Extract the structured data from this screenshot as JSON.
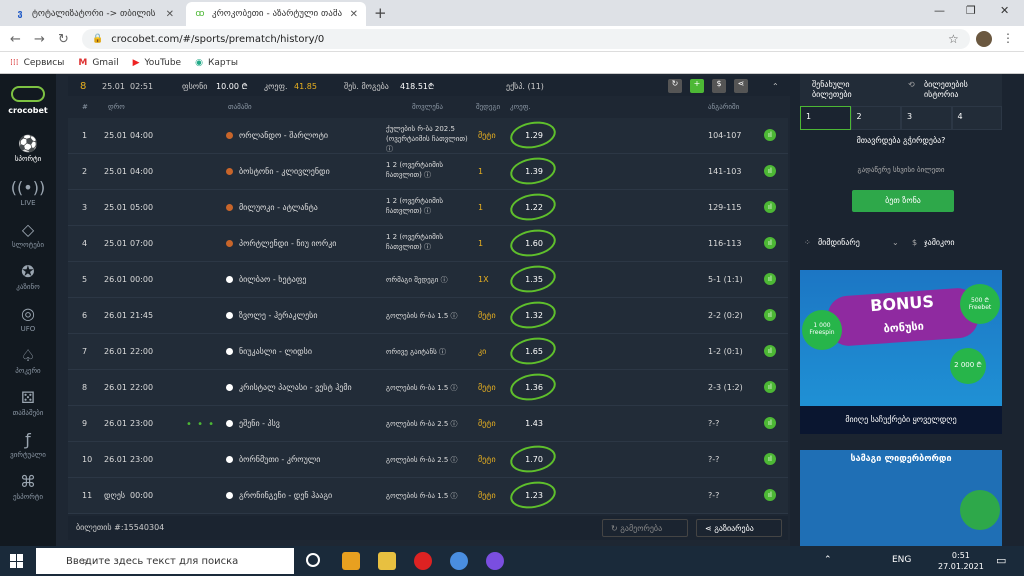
{
  "browser": {
    "tabs": [
      {
        "title": "ტოტალიზატორი -> თბილის",
        "icon": "tab-icon"
      },
      {
        "title": "კროკობეთი - აზარტული თამა",
        "icon": "crocobet-icon"
      }
    ],
    "url": "crocobet.com/#/sports/prematch/history/0",
    "bookmarks": [
      "Сервисы",
      "Gmail",
      "YouTube",
      "Карты"
    ]
  },
  "topbar": {
    "date": "25.01",
    "time": "02:51",
    "stake": "ფსონი",
    "stake_val": "10.00 ₾",
    "coef_label": "კოეფ.",
    "coef_val": "41.85",
    "win_label": "შეს. მოგება",
    "win_val": "418.51₾",
    "type": "ექსპ. (11)"
  },
  "headers": {
    "num": "#",
    "date": "დრო",
    "event": "თამაში",
    "market": "მოვლენა",
    "pick": "შედეგი",
    "odds": "კოეფ.",
    "result": "ანგარიში"
  },
  "rows": [
    {
      "num": "1",
      "date": "25.01",
      "time": "04:00",
      "sport": "ball",
      "event": "ორლანდო - შარლოტი",
      "market": "ქულების რ-ბა 202.5 (ოვერტაიმის ჩათვლით) ⓘ",
      "pick": "მეტი",
      "odds": "1.29",
      "score": "104-107",
      "circled": true
    },
    {
      "num": "2",
      "date": "25.01",
      "time": "04:00",
      "sport": "ball",
      "event": "ბოსტონი - კლივლენდი",
      "market": "1 2 (ოვერტაიმის ჩათვლით) ⓘ",
      "pick": "1",
      "odds": "1.39",
      "score": "141-103",
      "circled": true
    },
    {
      "num": "3",
      "date": "25.01",
      "time": "05:00",
      "sport": "ball",
      "event": "მილუოკი - ატლანტა",
      "market": "1 2 (ოვერტაიმის ჩათვლით) ⓘ",
      "pick": "1",
      "odds": "1.22",
      "score": "129-115",
      "circled": true
    },
    {
      "num": "4",
      "date": "25.01",
      "time": "07:00",
      "sport": "ball",
      "event": "პორტლენდი - ნიუ იორკი",
      "market": "1 2 (ოვერტაიმის ჩათვლით) ⓘ",
      "pick": "1",
      "odds": "1.60",
      "score": "116-113",
      "circled": true
    },
    {
      "num": "5",
      "date": "26.01",
      "time": "00:00",
      "sport": "foot",
      "event": "ბილბაო - ხეტაფე",
      "market": "ორმაგი შედეგი ⓘ",
      "pick": "1X",
      "odds": "1.35",
      "score": "5-1 (1:1)",
      "circled": true
    },
    {
      "num": "6",
      "date": "26.01",
      "time": "21:45",
      "sport": "foot",
      "event": "ზვოლე - ჰერაკლესი",
      "market": "გოლების რ-ბა 1.5 ⓘ",
      "pick": "მეტი",
      "odds": "1.32",
      "score": "2-2 (0:2)",
      "circled": true
    },
    {
      "num": "7",
      "date": "26.01",
      "time": "22:00",
      "sport": "foot",
      "event": "ნიუკასლი - ლიდსი",
      "market": "ორივე გაიტანს ⓘ",
      "pick": "კი",
      "odds": "1.65",
      "score": "1-2 (0:1)",
      "circled": true
    },
    {
      "num": "8",
      "date": "26.01",
      "time": "22:00",
      "sport": "foot",
      "event": "კრისტალ პალასი - ვესტ ჰემი",
      "market": "გოლების რ-ბა 1.5 ⓘ",
      "pick": "მეტი",
      "odds": "1.36",
      "score": "2-3 (1:2)",
      "circled": true
    },
    {
      "num": "9",
      "date": "26.01",
      "time": "23:00",
      "sport": "foot",
      "event": "ეშენი - პსვ",
      "market": "გოლების რ-ბა 2.5 ⓘ",
      "pick": "მეტი",
      "odds": "1.43",
      "score": "?-?",
      "circled": false,
      "live": "• • •"
    },
    {
      "num": "10",
      "date": "26.01",
      "time": "23:00",
      "sport": "foot",
      "event": "ბორნმუთი - კროული",
      "market": "გოლების რ-ბა 2.5 ⓘ",
      "pick": "მეტი",
      "odds": "1.70",
      "score": "?-?",
      "circled": true
    },
    {
      "num": "11",
      "date": "დღეს",
      "time": "00:00",
      "sport": "foot",
      "event": "გრონინგენი - დენ ჰააგი",
      "market": "გოლების რ-ბა 1.5 ⓘ",
      "pick": "მეტი",
      "odds": "1.23",
      "score": "?-?",
      "circled": true
    }
  ],
  "footer": {
    "ticket": "ბილეთის #:15540304",
    "repeat": "გამეორება",
    "share": "გაზიარება"
  },
  "leftnav": [
    "სპორტი",
    "LIVE",
    "სლოტები",
    "კაზინო",
    "UFO",
    "პოკერი",
    "თამაშები",
    "ვირტუალი",
    "ესპორტი"
  ],
  "logo": "crocobet",
  "right": {
    "tab1": "შენახული ბილეთები",
    "tab2": "ბილეთების ისტორია",
    "nums": [
      "1",
      "2",
      "3",
      "4"
    ],
    "empty": "მთავრდება გჭირდება?",
    "empty_sub": "გადაწერე სხვისი ბილეთი",
    "btn": "ბეთ ზონა",
    "fav": "მიმდინარე",
    "fav2": "ჯამიკოი",
    "banner1_title": "BONUS",
    "banner1_sub": "ბონუსი",
    "banner1_left": "1 000 Freespin",
    "banner1_right": "500 ₾ Freebet",
    "banner1_amt": "2 000 ₾",
    "banner1_cap": "მიიღე საჩუქრები ყოველდღე",
    "banner2": "სამაგი ლიდერბორდი"
  },
  "taskbar": {
    "search": "Введите здесь текст для поиска",
    "lang": "ENG",
    "time": "0:51",
    "date": "27.01.2021"
  }
}
